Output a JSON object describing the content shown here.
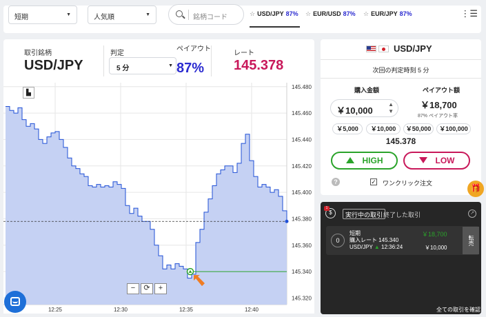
{
  "topbar": {
    "term_select": "短期",
    "sort_select": "人気順",
    "search_placeholder": "銘柄コード",
    "favorites": [
      {
        "pair": "USD/JPY",
        "payout": "87%",
        "active": true
      },
      {
        "pair": "EUR/USD",
        "payout": "87%",
        "active": false
      },
      {
        "pair": "EUR/JPY",
        "payout": "87%",
        "active": false
      }
    ],
    "menu_icon": "hamburger-icon"
  },
  "info": {
    "symbol_label": "取引銘柄",
    "symbol": "USD/JPY",
    "expiry_label": "判定",
    "expiry_value": "5 分",
    "payout_label": "ペイアウト",
    "payout_value": "87%",
    "rate_label": "レート",
    "rate_value": "145.378"
  },
  "colors": {
    "payout_blue": "#2b2bd0",
    "rate_red": "#c8185a",
    "high_green": "#2aa32a",
    "low_pink": "#c8185a",
    "area_fill": "#c5d1f3",
    "line_blue": "#1f4fd6"
  },
  "chart_data": {
    "type": "area",
    "x_ticks": [
      "12:25",
      "12:30",
      "12:35",
      "12:40"
    ],
    "y_ticks": [
      "145.480",
      "145.460",
      "145.440",
      "145.420",
      "145.400",
      "145.380",
      "145.360",
      "145.340",
      "145.320"
    ],
    "ylim": [
      145.315,
      145.483
    ],
    "current_rate": 145.378,
    "entry_rate": 145.34,
    "series": [
      {
        "values": [
          145.465,
          145.462,
          145.46,
          145.464,
          145.455,
          145.45,
          145.452,
          145.448,
          145.44,
          145.437,
          145.442,
          145.445,
          145.446,
          145.44,
          145.434,
          145.426,
          145.42,
          145.418,
          145.414,
          145.412,
          145.405,
          145.404,
          145.406,
          145.404,
          145.405,
          145.404,
          145.408,
          145.406,
          145.403,
          145.39,
          145.384,
          145.388,
          145.382,
          145.378,
          145.378,
          145.372,
          145.36,
          145.352,
          145.342,
          145.345,
          145.342,
          145.346,
          145.344,
          145.342,
          145.335,
          145.338,
          145.362,
          145.372,
          145.385,
          145.395,
          145.405,
          145.414,
          145.417,
          145.42,
          145.42,
          145.415,
          145.422,
          145.437,
          145.444,
          145.424,
          145.412,
          145.404,
          145.406,
          145.404,
          145.4,
          145.402,
          145.397,
          145.386,
          145.378
        ]
      }
    ]
  },
  "chart_controls": {
    "zoom_out": "−",
    "reset": "⟳",
    "zoom_in": "+",
    "mode_icon": "bar-chart-icon"
  },
  "trade": {
    "pair": "USD/JPY",
    "next_judgement": "次回の判定時刻 5 分",
    "purchase_label": "購入金額",
    "purchase_value": "￥10,000",
    "payout_amount_label": "ペイアウト額",
    "payout_amount": "￥18,700",
    "payout_rate_pct": "87%",
    "payout_rate_label": "ペイアウト率",
    "quick_amounts": [
      "￥5,000",
      "￥10,000",
      "￥50,000",
      "￥100,000"
    ],
    "rate": "145.378",
    "high_label": "HIGH",
    "low_label": "LOW",
    "one_click_label": "ワンクリック注文",
    "help_glyph": "?",
    "check_glyph": "✓"
  },
  "positions": {
    "badge_count": "1",
    "tab_active": "実行中の取引",
    "tab_closed": "終了した取引",
    "card": {
      "index": "0",
      "term": "短期",
      "entry_label": "購入レート",
      "entry_rate": "145.340",
      "pair": "USD/JPY",
      "time": "12:36:24",
      "payout": "￥18,700",
      "amount": "￥10,000",
      "sell_label": "転売"
    },
    "footer_link": "全ての取引を確認"
  },
  "gift_icon": "gift-icon",
  "chat_icon": "chat-icon"
}
